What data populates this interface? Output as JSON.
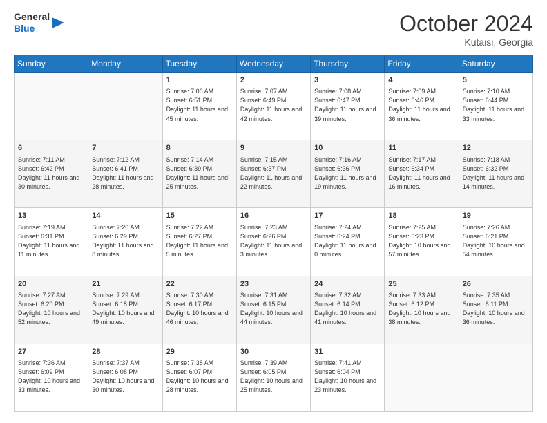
{
  "header": {
    "logo": {
      "line1": "General",
      "line2": "Blue"
    },
    "title": "October 2024",
    "location": "Kutaisi, Georgia"
  },
  "calendar": {
    "days_of_week": [
      "Sunday",
      "Monday",
      "Tuesday",
      "Wednesday",
      "Thursday",
      "Friday",
      "Saturday"
    ],
    "weeks": [
      [
        {
          "day": "",
          "empty": true
        },
        {
          "day": "",
          "empty": true
        },
        {
          "day": "1",
          "sunrise": "7:06 AM",
          "sunset": "6:51 PM",
          "daylight": "11 hours and 45 minutes."
        },
        {
          "day": "2",
          "sunrise": "7:07 AM",
          "sunset": "6:49 PM",
          "daylight": "11 hours and 42 minutes."
        },
        {
          "day": "3",
          "sunrise": "7:08 AM",
          "sunset": "6:47 PM",
          "daylight": "11 hours and 39 minutes."
        },
        {
          "day": "4",
          "sunrise": "7:09 AM",
          "sunset": "6:46 PM",
          "daylight": "11 hours and 36 minutes."
        },
        {
          "day": "5",
          "sunrise": "7:10 AM",
          "sunset": "6:44 PM",
          "daylight": "11 hours and 33 minutes."
        }
      ],
      [
        {
          "day": "6",
          "sunrise": "7:11 AM",
          "sunset": "6:42 PM",
          "daylight": "11 hours and 30 minutes."
        },
        {
          "day": "7",
          "sunrise": "7:12 AM",
          "sunset": "6:41 PM",
          "daylight": "11 hours and 28 minutes."
        },
        {
          "day": "8",
          "sunrise": "7:14 AM",
          "sunset": "6:39 PM",
          "daylight": "11 hours and 25 minutes."
        },
        {
          "day": "9",
          "sunrise": "7:15 AM",
          "sunset": "6:37 PM",
          "daylight": "11 hours and 22 minutes."
        },
        {
          "day": "10",
          "sunrise": "7:16 AM",
          "sunset": "6:36 PM",
          "daylight": "11 hours and 19 minutes."
        },
        {
          "day": "11",
          "sunrise": "7:17 AM",
          "sunset": "6:34 PM",
          "daylight": "11 hours and 16 minutes."
        },
        {
          "day": "12",
          "sunrise": "7:18 AM",
          "sunset": "6:32 PM",
          "daylight": "11 hours and 14 minutes."
        }
      ],
      [
        {
          "day": "13",
          "sunrise": "7:19 AM",
          "sunset": "6:31 PM",
          "daylight": "11 hours and 11 minutes."
        },
        {
          "day": "14",
          "sunrise": "7:20 AM",
          "sunset": "6:29 PM",
          "daylight": "11 hours and 8 minutes."
        },
        {
          "day": "15",
          "sunrise": "7:22 AM",
          "sunset": "6:27 PM",
          "daylight": "11 hours and 5 minutes."
        },
        {
          "day": "16",
          "sunrise": "7:23 AM",
          "sunset": "6:26 PM",
          "daylight": "11 hours and 3 minutes."
        },
        {
          "day": "17",
          "sunrise": "7:24 AM",
          "sunset": "6:24 PM",
          "daylight": "11 hours and 0 minutes."
        },
        {
          "day": "18",
          "sunrise": "7:25 AM",
          "sunset": "6:23 PM",
          "daylight": "10 hours and 57 minutes."
        },
        {
          "day": "19",
          "sunrise": "7:26 AM",
          "sunset": "6:21 PM",
          "daylight": "10 hours and 54 minutes."
        }
      ],
      [
        {
          "day": "20",
          "sunrise": "7:27 AM",
          "sunset": "6:20 PM",
          "daylight": "10 hours and 52 minutes."
        },
        {
          "day": "21",
          "sunrise": "7:29 AM",
          "sunset": "6:18 PM",
          "daylight": "10 hours and 49 minutes."
        },
        {
          "day": "22",
          "sunrise": "7:30 AM",
          "sunset": "6:17 PM",
          "daylight": "10 hours and 46 minutes."
        },
        {
          "day": "23",
          "sunrise": "7:31 AM",
          "sunset": "6:15 PM",
          "daylight": "10 hours and 44 minutes."
        },
        {
          "day": "24",
          "sunrise": "7:32 AM",
          "sunset": "6:14 PM",
          "daylight": "10 hours and 41 minutes."
        },
        {
          "day": "25",
          "sunrise": "7:33 AM",
          "sunset": "6:12 PM",
          "daylight": "10 hours and 38 minutes."
        },
        {
          "day": "26",
          "sunrise": "7:35 AM",
          "sunset": "6:11 PM",
          "daylight": "10 hours and 36 minutes."
        }
      ],
      [
        {
          "day": "27",
          "sunrise": "7:36 AM",
          "sunset": "6:09 PM",
          "daylight": "10 hours and 33 minutes."
        },
        {
          "day": "28",
          "sunrise": "7:37 AM",
          "sunset": "6:08 PM",
          "daylight": "10 hours and 30 minutes."
        },
        {
          "day": "29",
          "sunrise": "7:38 AM",
          "sunset": "6:07 PM",
          "daylight": "10 hours and 28 minutes."
        },
        {
          "day": "30",
          "sunrise": "7:39 AM",
          "sunset": "6:05 PM",
          "daylight": "10 hours and 25 minutes."
        },
        {
          "day": "31",
          "sunrise": "7:41 AM",
          "sunset": "6:04 PM",
          "daylight": "10 hours and 23 minutes."
        },
        {
          "day": "",
          "empty": true
        },
        {
          "day": "",
          "empty": true
        }
      ]
    ],
    "labels": {
      "sunrise": "Sunrise:",
      "sunset": "Sunset:",
      "daylight": "Daylight:"
    }
  }
}
